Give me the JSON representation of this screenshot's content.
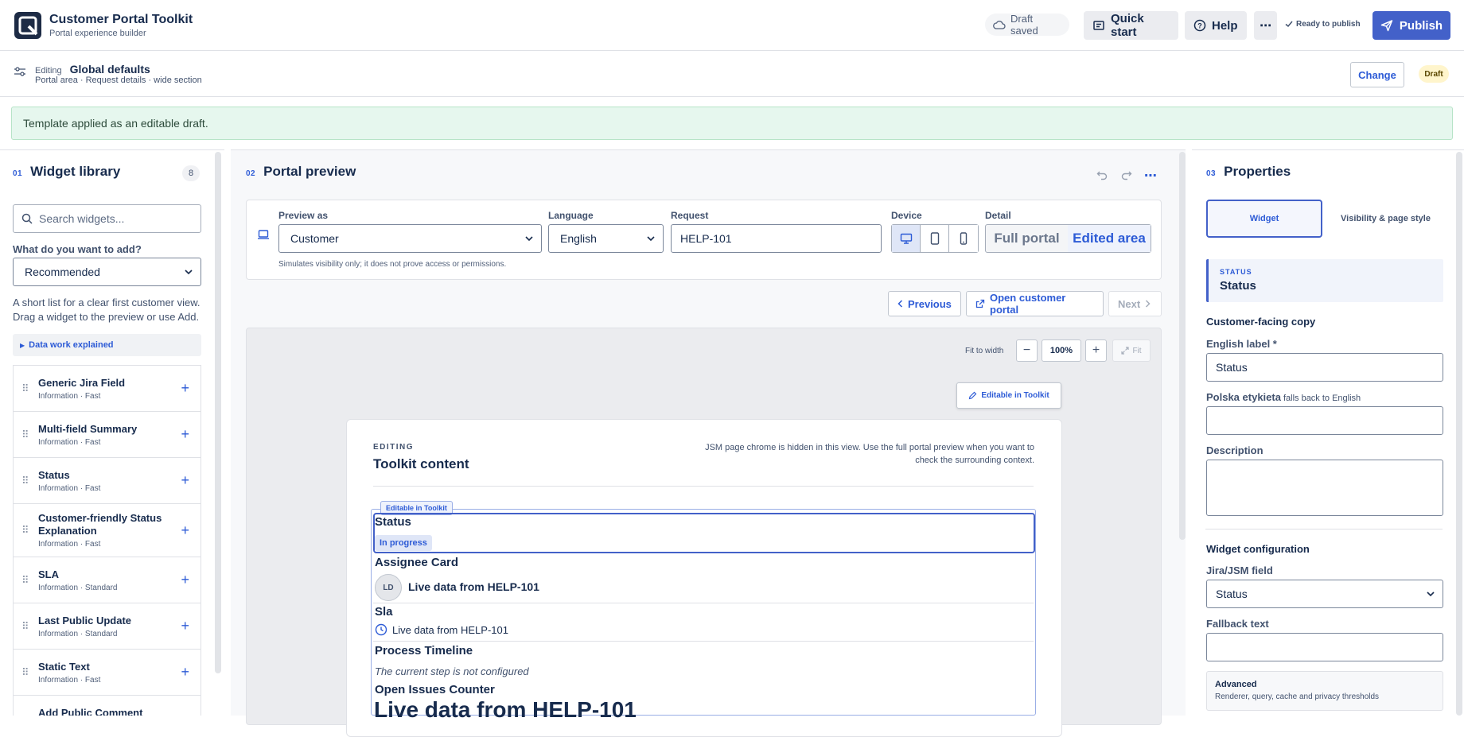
{
  "app": {
    "title": "Customer Portal Toolkit",
    "subtitle": "Portal experience builder"
  },
  "topbar": {
    "draft_saved": "Draft saved",
    "quick_start": "Quick start",
    "help": "Help",
    "more": "⋯",
    "ready": "Ready to publish",
    "publish": "Publish"
  },
  "context": {
    "editing_label": "Editing",
    "editing_value": "Global defaults",
    "path": "Portal area · Request details · wide section",
    "change": "Change",
    "status": "Draft"
  },
  "notice": "Template applied as an editable draft.",
  "library": {
    "num": "01",
    "title": "Widget library",
    "count": "8",
    "search_placeholder": "Search widgets...",
    "question": "What do you want to add?",
    "filter_value": "Recommended",
    "help_line1": "A short list for a clear first customer view.",
    "help_line2": "Drag a widget to the preview or use Add.",
    "explain": "Data work explained",
    "items": [
      {
        "name": "Generic Jira Field",
        "meta": "Information · Fast"
      },
      {
        "name": "Multi-field Summary",
        "meta": "Information · Fast"
      },
      {
        "name": "Status",
        "meta": "Information · Fast"
      },
      {
        "name": "Customer-friendly Status Explanation",
        "meta": "Information · Fast"
      },
      {
        "name": "SLA",
        "meta": "Information · Standard"
      },
      {
        "name": "Last Public Update",
        "meta": "Information · Standard"
      },
      {
        "name": "Static Text",
        "meta": "Information · Fast"
      },
      {
        "name": "Add Public Comment",
        "meta": ""
      }
    ]
  },
  "preview": {
    "num": "02",
    "title": "Portal preview",
    "preview_as_label": "Preview as",
    "preview_as": "Customer",
    "language_label": "Language",
    "language": "English",
    "request_label": "Request",
    "request": "HELP-101",
    "device_label": "Device",
    "detail_label": "Detail",
    "detail_full": "Full portal",
    "detail_edited": "Edited area",
    "hint": "Simulates visibility only; it does not prove access or permissions.",
    "previous": "Previous",
    "open_portal": "Open customer portal",
    "next": "Next",
    "fit_to_width": "Fit to width",
    "zoom": "100%",
    "fit": "Fit",
    "editable_tag": "Editable in Toolkit"
  },
  "card": {
    "kicker": "EDITING",
    "title": "Toolkit content",
    "note": "JSM page chrome is hidden in this view. Use the full portal preview when you want to check the surrounding context.",
    "mini_tag": "Editable in Toolkit",
    "status_title": "Status",
    "status_value": "In progress",
    "assignee_title": "Assignee Card",
    "avatar": "LD",
    "assignee_value": "Live data from HELP-101",
    "sla_title": "Sla",
    "sla_value": "Live data from HELP-101",
    "timeline_title": "Process Timeline",
    "timeline_value": "The current step is not configured",
    "issues_title": "Open Issues Counter",
    "issues_value": "Live data from HELP-101"
  },
  "properties": {
    "num": "03",
    "title": "Properties",
    "tab_widget": "Widget",
    "tab_visibility": "Visibility & page style",
    "selected_kicker": "STATUS",
    "selected_name": "Status",
    "copy_heading": "Customer-facing copy",
    "english_label": "English label *",
    "english_value": "Status",
    "polish_label": "Polska etykieta",
    "polish_hint": "falls back to English",
    "description_label": "Description",
    "config_heading": "Widget configuration",
    "field_label": "Jira/JSM field",
    "field_value": "Status",
    "fallback_label": "Fallback text",
    "advanced_title": "Advanced",
    "advanced_sub": "Renderer, query, cache and privacy thresholds"
  },
  "colors": {
    "accent": "#4361c9",
    "link": "#2d5bd6",
    "notice_bg": "#e6f7ee",
    "draft_bg": "#fff5cc"
  }
}
